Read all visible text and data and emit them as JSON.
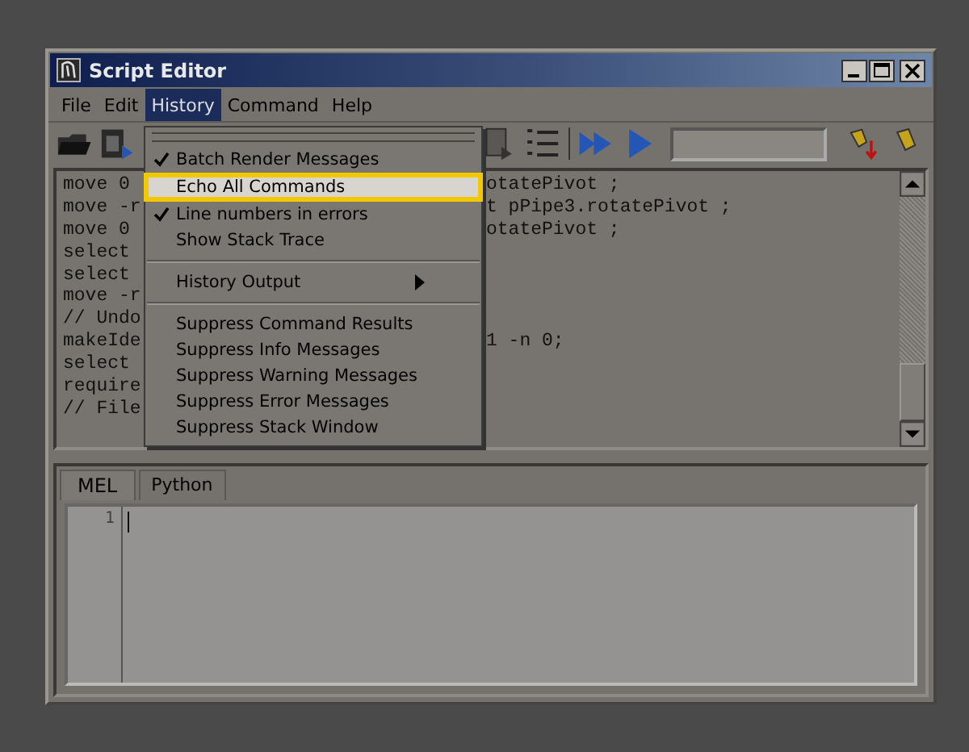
{
  "window": {
    "title": "Script Editor"
  },
  "menubar": [
    {
      "label": "File",
      "selected": false
    },
    {
      "label": "Edit",
      "selected": false
    },
    {
      "label": "History",
      "selected": true
    },
    {
      "label": "Command",
      "selected": false
    },
    {
      "label": "Help",
      "selected": false
    }
  ],
  "history_menu": [
    {
      "kind": "item",
      "label": "Batch Render Messages",
      "checked": true,
      "selected": false
    },
    {
      "kind": "item",
      "label": "Echo All Commands",
      "checked": false,
      "selected": true
    },
    {
      "kind": "item",
      "label": "Line numbers in errors",
      "checked": true,
      "selected": false
    },
    {
      "kind": "item",
      "label": "Show Stack Trace",
      "checked": false,
      "selected": false
    },
    {
      "kind": "separator"
    },
    {
      "kind": "submenu",
      "label": "History Output",
      "checked": false,
      "selected": false
    },
    {
      "kind": "separator"
    },
    {
      "kind": "item",
      "label": "Suppress Command Results",
      "checked": false,
      "selected": false
    },
    {
      "kind": "item",
      "label": "Suppress Info Messages",
      "checked": false,
      "selected": false
    },
    {
      "kind": "item",
      "label": "Suppress Warning Messages",
      "checked": false,
      "selected": false
    },
    {
      "kind": "item",
      "label": "Suppress Error Messages",
      "checked": false,
      "selected": false
    },
    {
      "kind": "item",
      "label": "Suppress Stack Window",
      "checked": false,
      "selected": false
    }
  ],
  "output_lines": [
    {
      "left": "move 0",
      "right": "otatePivot ;"
    },
    {
      "left": "move -r",
      "right": "t pPipe3.rotatePivot ;"
    },
    {
      "left": "move 0",
      "right": "otatePivot ;"
    },
    {
      "left": "select"
    },
    {
      "left": "select"
    },
    {
      "left": "move -r"
    },
    {
      "left": "// Undo"
    },
    {
      "left": "makeIde",
      "right": "1 -n 0;"
    },
    {
      "left": "select"
    },
    {
      "left": "require"
    },
    {
      "left": "// File"
    }
  ],
  "editor_tabs": [
    {
      "label": "MEL",
      "selected": true
    },
    {
      "label": "Python",
      "selected": false
    }
  ],
  "editor": {
    "line_numbers": [
      "1"
    ]
  }
}
